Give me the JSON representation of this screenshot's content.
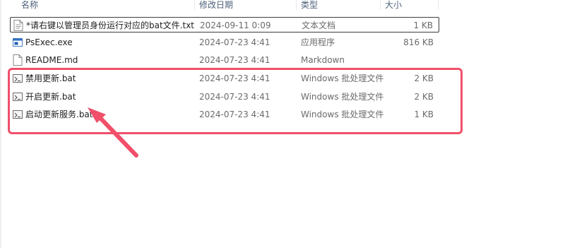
{
  "columns": {
    "name": "名称",
    "date": "修改日期",
    "type": "类型",
    "size": "大小"
  },
  "files": [
    {
      "name": "*请右键以管理员身份运行对应的bat文件.txt",
      "date": "2024-09-11 0:09",
      "type": "文本文档",
      "size": "1 KB",
      "icon": "text-file-icon"
    },
    {
      "name": "PsExec.exe",
      "date": "2024-07-23 4:41",
      "type": "应用程序",
      "size": "816 KB",
      "icon": "exe-file-icon"
    },
    {
      "name": "README.md",
      "date": "2024-07-23 4:41",
      "type": "Markdown",
      "size": "",
      "icon": "blank-file-icon"
    },
    {
      "name": "禁用更新.bat",
      "date": "2024-07-23 4:41",
      "type": "Windows 批处理文件",
      "size": "2 KB",
      "icon": "bat-file-icon"
    },
    {
      "name": "开启更新.bat",
      "date": "2024-07-23 4:41",
      "type": "Windows 批处理文件",
      "size": "2 KB",
      "icon": "bat-file-icon"
    },
    {
      "name": "启动更新服务.bat",
      "date": "2024-07-23 4:41",
      "type": "Windows 批处理文件",
      "size": "1 KB",
      "icon": "bat-file-icon"
    }
  ],
  "annotation": {
    "highlight_color": "#f0506a",
    "arrow_color": "#f0506a"
  }
}
